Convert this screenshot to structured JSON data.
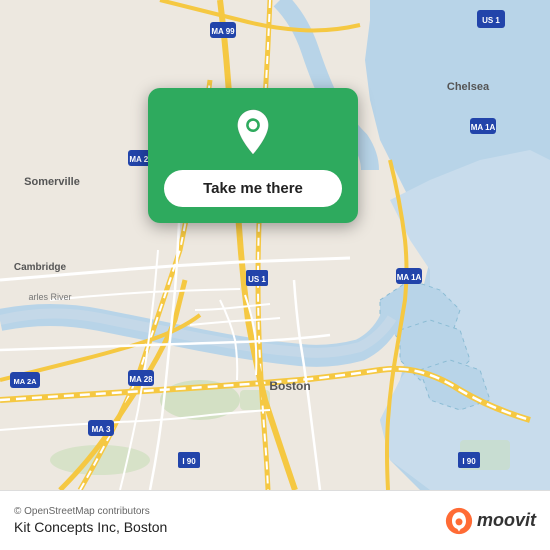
{
  "map": {
    "background_color": "#e8e0d8",
    "water_color": "#b8d4e8",
    "road_color_major": "#f5c842",
    "road_color_minor": "#ffffff",
    "area_color": "#d4e8c8"
  },
  "popup": {
    "background_color": "#2eaa5e",
    "button_label": "Take me there",
    "pin_color": "#ffffff"
  },
  "bottom_bar": {
    "credit": "© OpenStreetMap contributors",
    "location_title": "Kit Concepts Inc, Boston",
    "moovit_label": "moovit"
  }
}
